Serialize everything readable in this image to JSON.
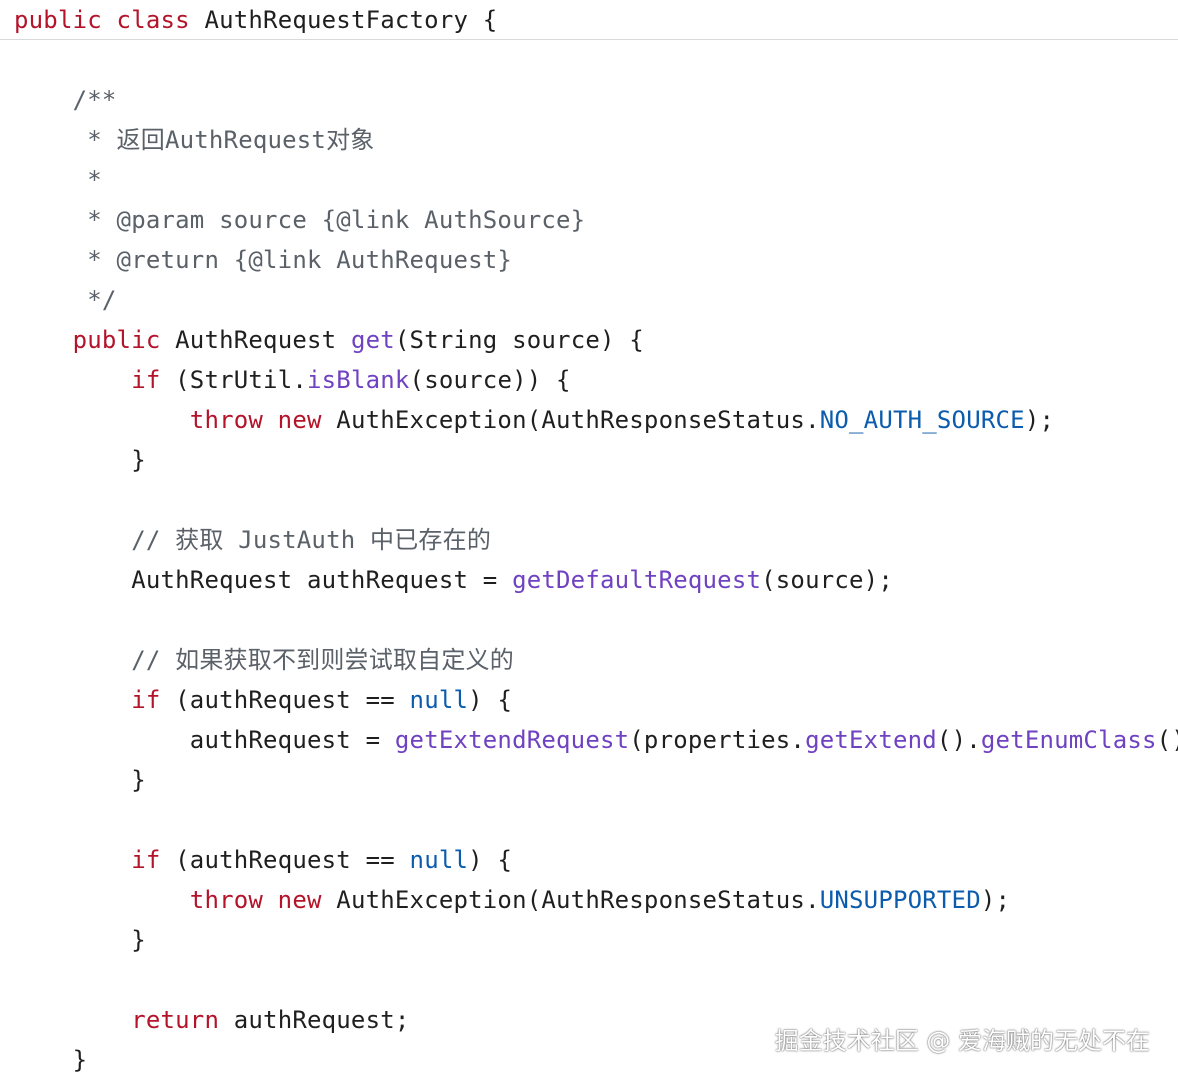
{
  "code_lines": [
    [
      {
        "t": "public class",
        "c": "kw"
      },
      {
        "t": " AuthRequestFactory {",
        "c": "tx"
      }
    ],
    [],
    [
      {
        "t": "    /**",
        "c": "cm"
      }
    ],
    [
      {
        "t": "     * 返回AuthRequest对象",
        "c": "cm"
      }
    ],
    [
      {
        "t": "     *",
        "c": "cm"
      }
    ],
    [
      {
        "t": "     * @param source {@link AuthSource}",
        "c": "cm"
      }
    ],
    [
      {
        "t": "     * @return {@link AuthRequest}",
        "c": "cm"
      }
    ],
    [
      {
        "t": "     */",
        "c": "cm"
      }
    ],
    [
      {
        "t": "    public",
        "c": "kw"
      },
      {
        "t": " AuthRequest ",
        "c": "tx"
      },
      {
        "t": "get",
        "c": "fn"
      },
      {
        "t": "(String source) {",
        "c": "tx"
      }
    ],
    [
      {
        "t": "        if",
        "c": "kw"
      },
      {
        "t": " (StrUtil.",
        "c": "tx"
      },
      {
        "t": "isBlank",
        "c": "fn"
      },
      {
        "t": "(source)) {",
        "c": "tx"
      }
    ],
    [
      {
        "t": "            throw new",
        "c": "kw"
      },
      {
        "t": " AuthException(AuthResponseStatus.",
        "c": "tx"
      },
      {
        "t": "NO_AUTH_SOURCE",
        "c": "cn"
      },
      {
        "t": ");",
        "c": "tx"
      }
    ],
    [
      {
        "t": "        }",
        "c": "tx"
      }
    ],
    [],
    [
      {
        "t": "        // 获取 JustAuth 中已存在的",
        "c": "cm"
      }
    ],
    [
      {
        "t": "        AuthRequest authRequest = ",
        "c": "tx"
      },
      {
        "t": "getDefaultRequest",
        "c": "fn"
      },
      {
        "t": "(source);",
        "c": "tx"
      }
    ],
    [],
    [
      {
        "t": "        // 如果获取不到则尝试取自定义的",
        "c": "cm"
      }
    ],
    [
      {
        "t": "        if",
        "c": "kw"
      },
      {
        "t": " (authRequest == ",
        "c": "tx"
      },
      {
        "t": "null",
        "c": "cn"
      },
      {
        "t": ") {",
        "c": "tx"
      }
    ],
    [
      {
        "t": "            authRequest = ",
        "c": "tx"
      },
      {
        "t": "getExtendRequest",
        "c": "fn"
      },
      {
        "t": "(properties.",
        "c": "tx"
      },
      {
        "t": "getExtend",
        "c": "fn"
      },
      {
        "t": "().",
        "c": "tx"
      },
      {
        "t": "getEnumClass",
        "c": "fn"
      },
      {
        "t": "(),",
        "c": "tx"
      }
    ],
    [
      {
        "t": "        }",
        "c": "tx"
      }
    ],
    [],
    [
      {
        "t": "        if",
        "c": "kw"
      },
      {
        "t": " (authRequest == ",
        "c": "tx"
      },
      {
        "t": "null",
        "c": "cn"
      },
      {
        "t": ") {",
        "c": "tx"
      }
    ],
    [
      {
        "t": "            throw new",
        "c": "kw"
      },
      {
        "t": " AuthException(AuthResponseStatus.",
        "c": "tx"
      },
      {
        "t": "UNSUPPORTED",
        "c": "cn"
      },
      {
        "t": ");",
        "c": "tx"
      }
    ],
    [
      {
        "t": "        }",
        "c": "tx"
      }
    ],
    [],
    [
      {
        "t": "        return",
        "c": "kw"
      },
      {
        "t": " authRequest;",
        "c": "tx"
      }
    ],
    [
      {
        "t": "    }",
        "c": "tx"
      }
    ]
  ],
  "watermark": "掘金技术社区 @ 爱海贼的无处不在"
}
